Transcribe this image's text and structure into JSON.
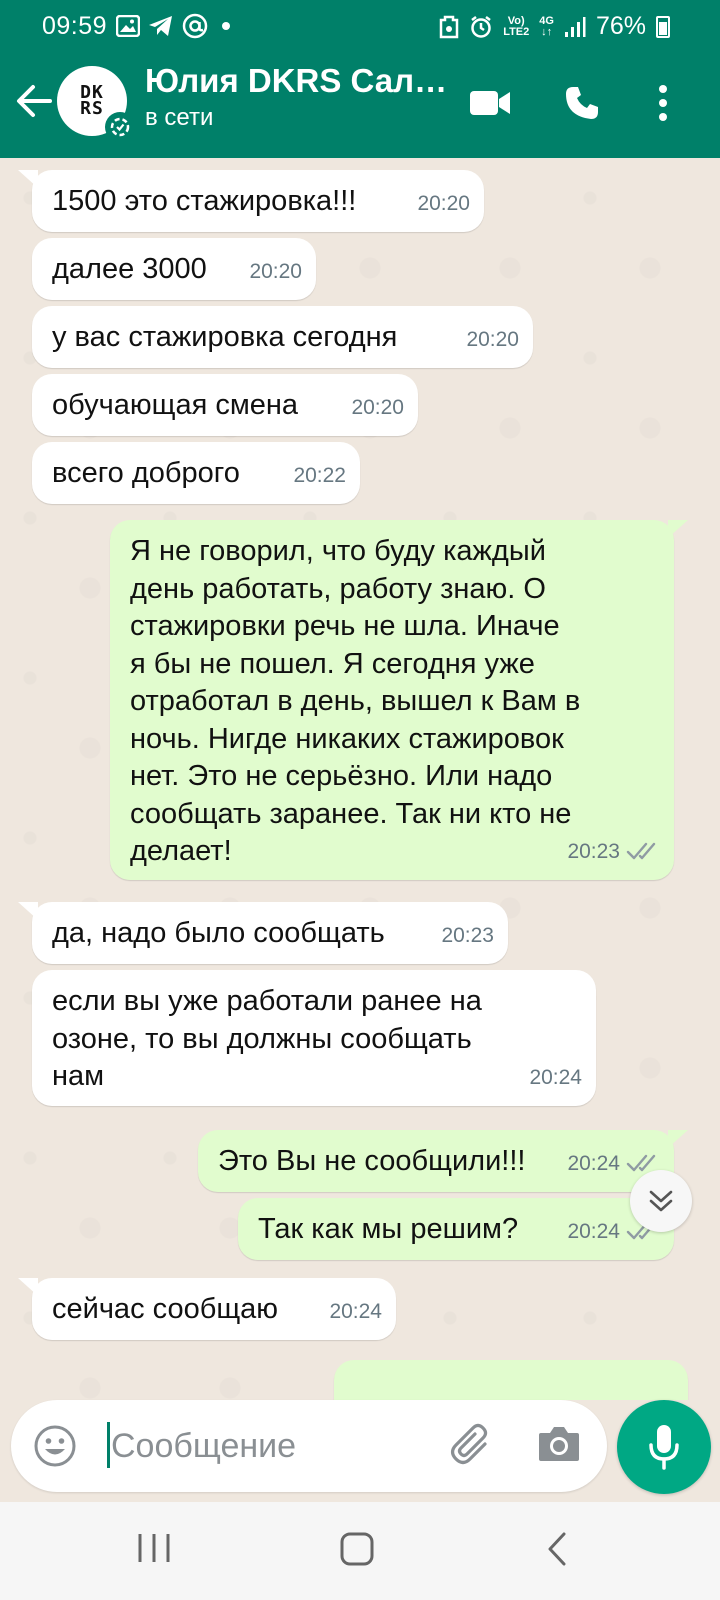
{
  "status_bar": {
    "time": "09:59",
    "net_top": "Vo)",
    "net_bottom": "LTE2",
    "network": "4G",
    "battery": "76%",
    "left_icons": [
      "gallery-icon",
      "telegram-icon",
      "at-icon",
      "dot-icon"
    ],
    "right_icons": [
      "data-saver-icon",
      "alarm-icon",
      "volte-icon",
      "4g-icon",
      "signal-icon",
      "battery-icon"
    ]
  },
  "header": {
    "contact_name": "Юлия DKRS Сал…",
    "presence": "в сети",
    "avatar_logo_top": "DK",
    "avatar_logo_bottom": "RS",
    "icons": [
      "back-arrow-icon",
      "video-call-icon",
      "phone-icon",
      "more-vert-icon"
    ]
  },
  "messages": [
    {
      "dir": "in",
      "text": "1500 это стажировка!!!",
      "time": "20:20"
    },
    {
      "dir": "in",
      "text": "далее 3000",
      "time": "20:20"
    },
    {
      "dir": "in",
      "text": "у вас стажировка сегодня",
      "time": "20:20"
    },
    {
      "dir": "in",
      "text": "обучающая смена",
      "time": "20:20"
    },
    {
      "dir": "in",
      "text": "всего доброго",
      "time": "20:22"
    },
    {
      "dir": "out",
      "text": "Я не говорил, что буду каждый\nдень работать, работу знаю. О\nстажировки речь не шла. Иначе\nя бы не пошел. Я сегодня уже\nотработал в день, вышел к Вам в\nночь. Нигде никаких стажировок\nнет. Это не серьёзно. Или надо\nсообщать заранее. Так ни кто не\nделает!",
      "time": "20:23",
      "read": true
    },
    {
      "dir": "in",
      "text": "да, надо было сообщать",
      "time": "20:23"
    },
    {
      "dir": "in",
      "text": "если вы уже работали ранее на\nозоне, то вы должны сообщать\nнам",
      "time": "20:24"
    },
    {
      "dir": "out",
      "text": "Это Вы не сообщили!!!",
      "time": "20:24",
      "read": true
    },
    {
      "dir": "out",
      "text": "Так как мы решим?",
      "time": "20:24",
      "read": true
    },
    {
      "dir": "in",
      "text": "сейчас сообщаю",
      "time": "20:24"
    }
  ],
  "composer": {
    "placeholder": "Сообщение",
    "value": ""
  },
  "colors": {
    "header": "#008069",
    "outgoing_bubble": "#e1fcce",
    "incoming_bubble": "#ffffff",
    "chat_background": "#efe7de",
    "mic_button": "#00a884",
    "read_ticks": "#8f9ba3"
  }
}
